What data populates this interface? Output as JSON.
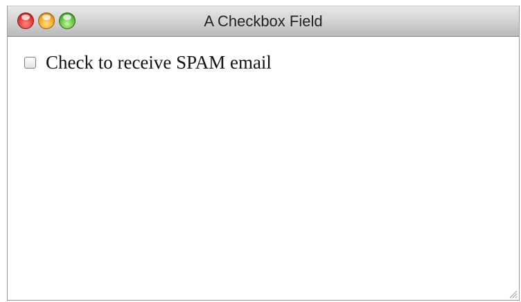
{
  "window": {
    "title": "A Checkbox Field"
  },
  "form": {
    "checkbox_label": "Check to receive SPAM email",
    "checkbox_checked": false
  },
  "icons": {
    "close": "close-traffic-light",
    "minimize": "minimize-traffic-light",
    "zoom": "zoom-traffic-light",
    "resize": "resize-grip-icon"
  }
}
